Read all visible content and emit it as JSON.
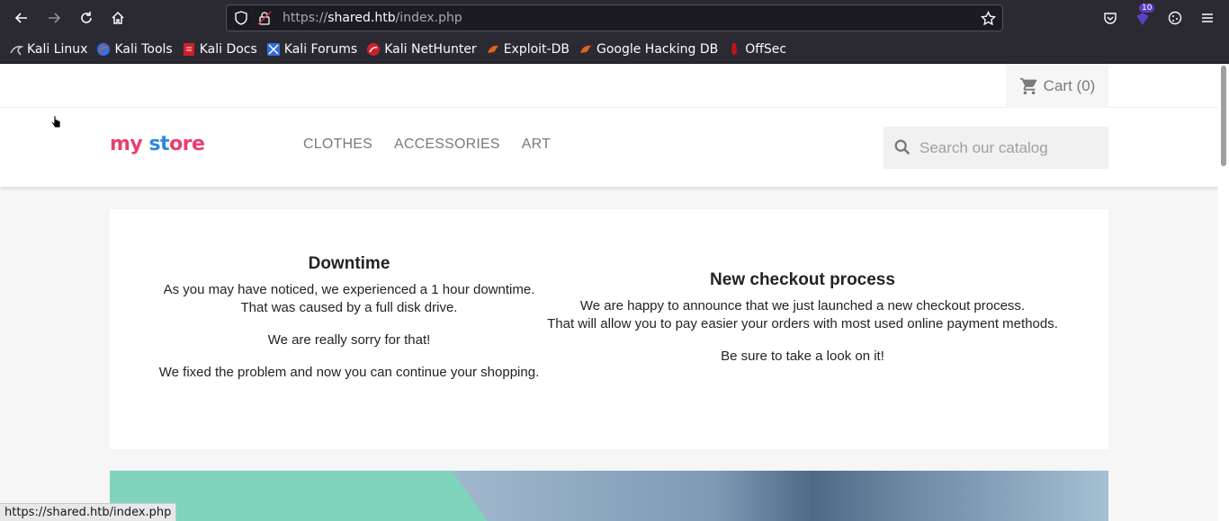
{
  "browser": {
    "url_scheme": "https://",
    "url_host": "shared.htb",
    "url_path": "/index.php",
    "extension_badge": "10",
    "bookmarks": [
      {
        "label": "Kali Linux",
        "icon": "kali-dragon-icon",
        "color": "#c8c8c8"
      },
      {
        "label": "Kali Tools",
        "icon": "kali-tools-icon",
        "color": "#3b6fd6"
      },
      {
        "label": "Kali Docs",
        "icon": "kali-docs-icon",
        "color": "#d11f2a"
      },
      {
        "label": "Kali Forums",
        "icon": "kali-forums-icon",
        "color": "#2f6fd8"
      },
      {
        "label": "Kali NetHunter",
        "icon": "kali-nethunter-icon",
        "color": "#d11f2a"
      },
      {
        "label": "Exploit-DB",
        "icon": "exploit-db-icon",
        "color": "#e0611c"
      },
      {
        "label": "Google Hacking DB",
        "icon": "ghdb-icon",
        "color": "#e0611c"
      },
      {
        "label": "OffSec",
        "icon": "offsec-icon",
        "color": "#c4121c"
      }
    ],
    "status_url": "https://shared.htb/index.php"
  },
  "site": {
    "cart_label": "Cart",
    "cart_count": "(0)",
    "logo_parts": [
      "my",
      " ",
      "st",
      "ore"
    ],
    "menu": [
      "CLOTHES",
      "ACCESSORIES",
      "ART"
    ],
    "search_placeholder": "Search our catalog"
  },
  "content": {
    "left": {
      "title": "Downtime",
      "p1_line1": "As you may have noticed, we experienced a 1 hour downtime.",
      "p1_line2": "That was caused by a full disk drive.",
      "p2": "We are really sorry for that!",
      "p3": "We fixed the problem and now you can continue your shopping."
    },
    "right": {
      "title": "New checkout process",
      "p1_line1": "We are happy to announce that we just launched a new checkout process.",
      "p1_line2": "That will allow you to pay easier your orders with most used online payment methods.",
      "p2": "Be sure to take a look on it!"
    }
  },
  "colors": {
    "chrome_bg": "#2b2a33",
    "accent_green": "#7fd4bb",
    "text_dark": "#232323",
    "text_muted": "#7a7a7a"
  }
}
